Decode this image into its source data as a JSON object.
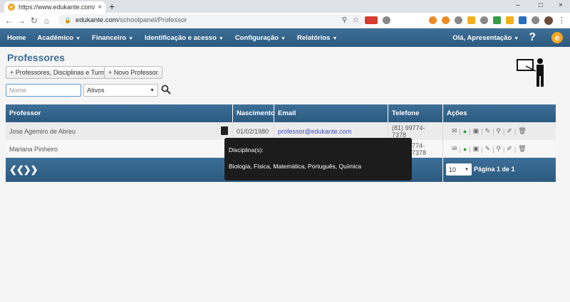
{
  "browser": {
    "tab_title": "https://www.edukante.com/scho",
    "tab_close": "×",
    "new_tab": "+",
    "url_host": "edukante.com",
    "url_path": "/schoolpanel/Professor",
    "win_min": "–",
    "win_max": "□",
    "win_close": "×"
  },
  "navbar": {
    "items": [
      {
        "label": "Home",
        "caret": false
      },
      {
        "label": "Acadêmico",
        "caret": true
      },
      {
        "label": "Financeiro",
        "caret": true
      },
      {
        "label": "Identificação e acesso",
        "caret": true
      },
      {
        "label": "Configuração",
        "caret": true
      },
      {
        "label": "Relatórios",
        "caret": true
      }
    ],
    "user": "Olá, Apresentação",
    "help": "?",
    "brand": "e"
  },
  "page": {
    "title": "Professores",
    "btn_professors": "+ Professores, Disciplinas e Turmas",
    "btn_new": "+ Novo Professor",
    "name_placeholder": "Nome",
    "status_value": "Ativos"
  },
  "table": {
    "headers": [
      "Professor",
      "Nascimento",
      "Email",
      "Telefone",
      "Ações"
    ],
    "rows": [
      {
        "name": "Jose Agemiro de Abreu",
        "birth": "01/02/1980",
        "email": "professor@edukante.com",
        "phone": "(81) 99774-7378"
      },
      {
        "name": "Mariana Pinheiro",
        "birth": "",
        "email": "",
        "phone": "774-7378"
      }
    ],
    "pager_arrows": "❮❮❯❯",
    "page_size": "10",
    "page_info": "Página 1 de 1"
  },
  "tooltip": {
    "title": "Disciplina(s):",
    "subjects": "Biologia, Física, Matemática, Português, Química"
  },
  "colors": {
    "header_blue": "#2c5a80",
    "title_blue": "#3d6d93",
    "link_blue": "#3c4fc4",
    "brand_orange": "#f5a623"
  }
}
